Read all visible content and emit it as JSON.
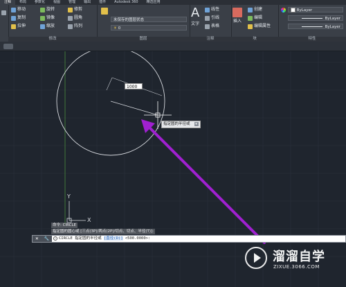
{
  "ribbon": {
    "tabs": [
      "注释",
      "布局",
      "参数化",
      "视图",
      "管理",
      "输出",
      "插件",
      "Autodesk 360",
      "精选应用"
    ],
    "active_tab": 0,
    "modify": {
      "title": "修改",
      "items": [
        "移动",
        "旋转",
        "修剪",
        "复制",
        "镜像",
        "圆角",
        "拉伸",
        "缩放",
        "阵列"
      ]
    },
    "layers": {
      "title": "图层",
      "state": "未保存的图层状态",
      "current": "0"
    },
    "annotation": {
      "title": "注释",
      "text_label": "文字",
      "items": [
        "线性",
        "引线",
        "表格"
      ]
    },
    "block": {
      "title": "块",
      "insert_label": "插入",
      "items": [
        "创建",
        "编辑",
        "编辑属性"
      ]
    },
    "properties": {
      "title": "特性",
      "items": [
        "ByLayer",
        "ByLayer",
        "ByLayer"
      ]
    }
  },
  "canvas": {
    "dimension_input": "1000",
    "tooltip": "指定圆的半径或",
    "ucs_y": "Y",
    "ucs_x": "X"
  },
  "history": [
    "命令: CIRCLE",
    "指定圆的圆心或 [三点(3P)/两点(2P)/切点、切点、半径(T)]:"
  ],
  "command_line": {
    "prefix": "CIRCLE 指定圆的半径或 ",
    "option": "[直径(D)]",
    "suffix": " <500.0000>:"
  },
  "watermark": {
    "title": "溜溜自学",
    "url": "ZIXUE.3066.COM"
  },
  "colors": {
    "canvas_bg": "#1f252e",
    "arrow": "#a020d0",
    "ribbon_bg": "#3a3f47"
  }
}
